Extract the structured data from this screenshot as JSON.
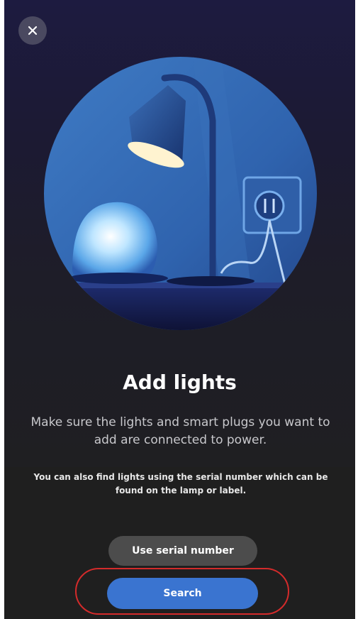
{
  "dialog": {
    "title": "Add lights",
    "description": "Make sure the lights and smart plugs you want to add are connected to power.",
    "hint": "You can also find lights using the serial number which can be found on the lamp or label.",
    "serial_button_label": "Use serial number",
    "search_button_label": "Search"
  },
  "icons": {
    "close": "close-icon",
    "hero": "lamp-illustration"
  },
  "colors": {
    "background": "#1f1f21",
    "primary_button": "#3a74d0",
    "secondary_button": "#4c4c4c",
    "highlight": "#d42b2b"
  }
}
